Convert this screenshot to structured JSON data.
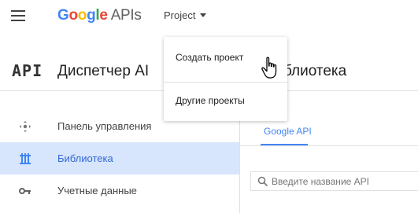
{
  "header": {
    "logo_google": [
      "G",
      "o",
      "o",
      "g",
      "l",
      "e"
    ],
    "logo_suffix": "APIs",
    "project_label": "Project"
  },
  "subheader": {
    "api_mark": "API",
    "manager_title": "Диспетчер AI",
    "library_title": "блиотека"
  },
  "project_menu": {
    "items": [
      {
        "label": "Создать проект"
      },
      {
        "label": "Другие проекты"
      }
    ]
  },
  "sidebar": {
    "items": [
      {
        "label": "Панель управления",
        "icon": "dashboard-icon",
        "active": false
      },
      {
        "label": "Библиотека",
        "icon": "library-icon",
        "active": true
      },
      {
        "label": "Учетные данные",
        "icon": "key-icon",
        "active": false
      }
    ]
  },
  "main": {
    "tabs": [
      {
        "label": "Google API"
      }
    ],
    "search": {
      "placeholder": "Введите название API",
      "value": ""
    }
  },
  "colors": {
    "accent": "#4285f4",
    "active_bg": "#d7e6fc",
    "active_text": "#3367d6"
  }
}
